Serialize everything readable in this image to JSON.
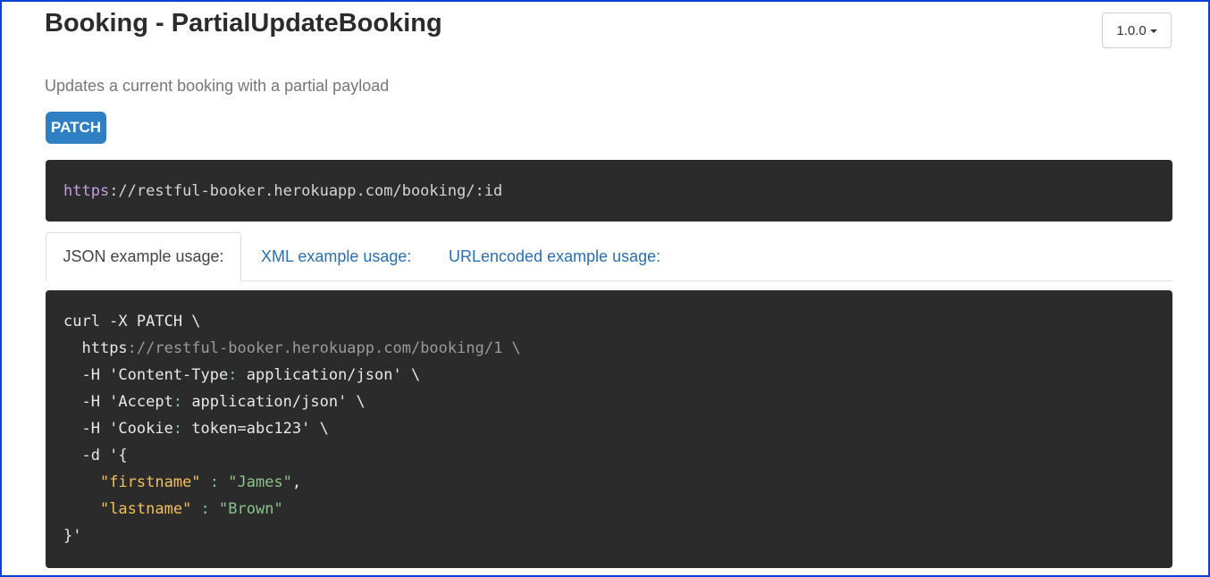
{
  "header": {
    "title": "Booking - PartialUpdateBooking",
    "version_label": "1.0.0"
  },
  "description": "Updates a current booking with a partial payload",
  "method": "PATCH",
  "url": {
    "protocol": "https",
    "rest": "://restful-booker.herokuapp.com/booking/:id"
  },
  "tabs": [
    {
      "label": "JSON example usage:",
      "active": true
    },
    {
      "label": "XML example usage:",
      "active": false
    },
    {
      "label": "URLencoded example usage:",
      "active": false
    }
  ],
  "code": {
    "line1": "curl -X PATCH \\",
    "line2_indent": "  ",
    "line2_proto": "https",
    "line2_rest": "://restful-booker.herokuapp.com/booking/1 \\",
    "line3_a": "  -H 'Content-Type",
    "line3_colon": ":",
    "line3_b": " application/json' \\",
    "line4_a": "  -H 'Accept",
    "line4_colon": ":",
    "line4_b": " application/json' \\",
    "line5_a": "  -H 'Cookie",
    "line5_colon": ":",
    "line5_b": " token=abc123' \\",
    "line6": "  -d '{",
    "line7_indent": "    ",
    "line7_key": "\"firstname\"",
    "line7_sep": " : ",
    "line7_val": "\"James\"",
    "line7_end": ",",
    "line8_indent": "    ",
    "line8_key": "\"lastname\"",
    "line8_sep": " : ",
    "line8_val": "\"Brown\"",
    "line9": "}'"
  },
  "colors": {
    "badge": "#2e7fc4",
    "code_bg": "#2b2b2b",
    "link": "#2a6fb0",
    "json_key": "#f3c05b",
    "json_string": "#8cc28c",
    "url_protocol": "#c59ee5"
  }
}
